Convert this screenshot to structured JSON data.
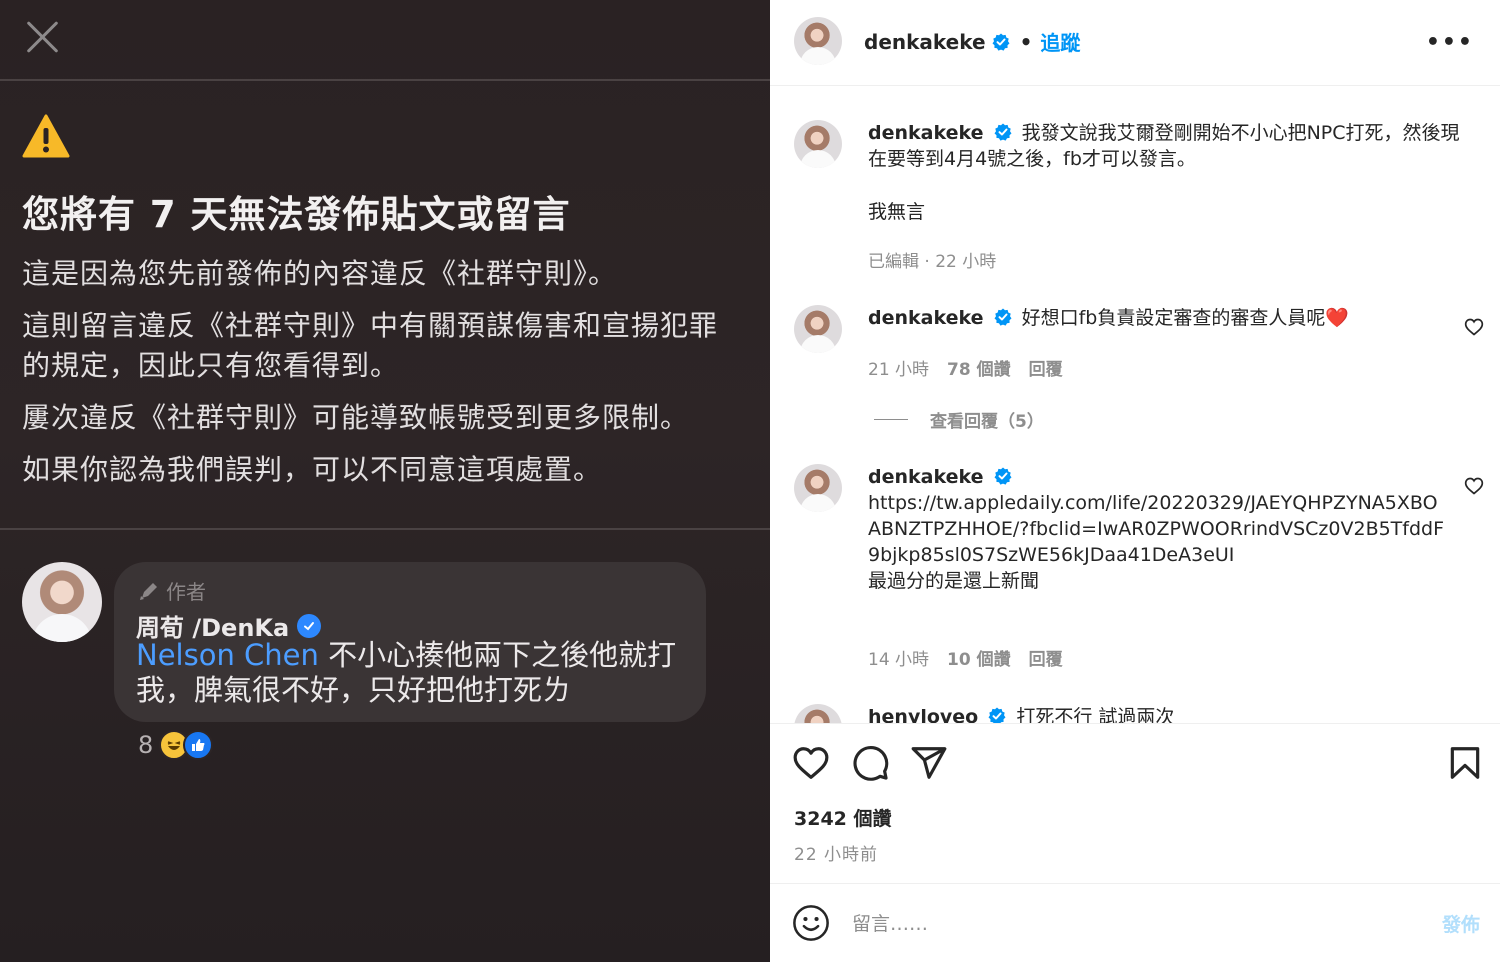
{
  "left": {
    "warning_title": "您將有 7 天無法發佈貼文或留言",
    "paragraphs": [
      "這是因為您先前發佈的內容違反《社群守則》。",
      "這則留言違反《社群守則》中有關預謀傷害和宣揚犯罪的規定，因此只有您看得到。",
      "屢次違反《社群守則》可能導致帳號受到更多限制。",
      "如果你認為我們誤判，可以不同意這項處置。"
    ],
    "comment": {
      "author_tag": "作者",
      "name": "周荀 /DenKa",
      "mention": "Nelson Chen",
      "text": " 不小心揍他兩下之後他就打我，脾氣很不好，只好把他打死ㄌ",
      "reaction_count": "8"
    }
  },
  "header": {
    "username": "denkakeke",
    "separator": "•",
    "follow_label": "追蹤",
    "more_label": "•••"
  },
  "caption": {
    "username": "denkakeke",
    "text": "我發文說我艾爾登剛開始不小心把NPC打死，然後現在要等到4月4號之後，fb才可以發言。",
    "text2": "我無言",
    "meta": "已編輯 · 22 小時"
  },
  "comments": [
    {
      "username": "denkakeke",
      "text": "好想口fb負責設定審查的審查人員呢❤️",
      "time": "21 小時",
      "likes": "78 個讚",
      "reply": "回覆",
      "view_replies": "查看回覆（5）"
    },
    {
      "username": "denkakeke",
      "text": "https://tw.appledaily.com/life/20220329/JAEYQHPZYNA5XBOABNZTPZHHOE/?fbclid=IwAR0ZPWOORrindVSCz0V2B5TfddF9bjkp85sl0S7SzWE56kJDaa41DeA3eUI",
      "text2": "最過分的是還上新聞",
      "time": "14 小時",
      "likes": "10 個讚",
      "reply": "回覆"
    },
    {
      "username": "henyloveo",
      "text": "打死不行 試過兩次"
    }
  ],
  "footer": {
    "likes": "3242 個讚",
    "time": "22 小時前",
    "comment_placeholder": "留言……",
    "post_label": "發佈"
  },
  "colors": {
    "accent": "#0095f6",
    "verified": "#0095f6",
    "fb_mention": "#4c9dff",
    "post_disabled": "#b2dffc"
  }
}
